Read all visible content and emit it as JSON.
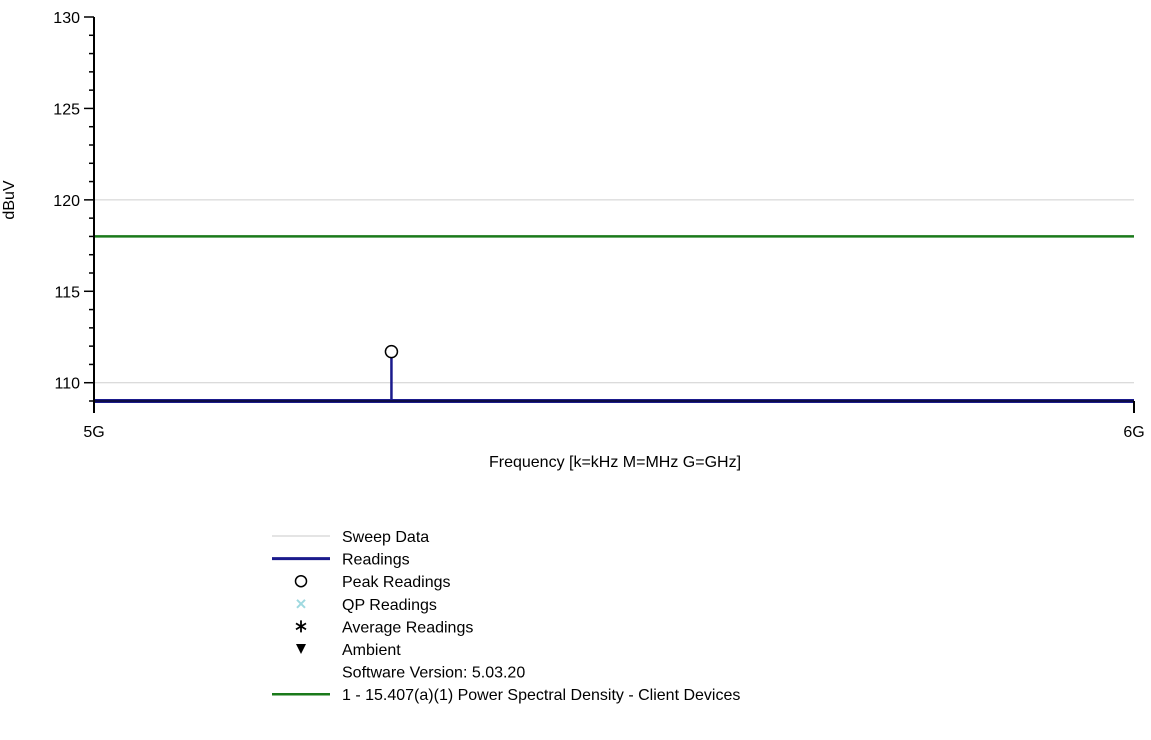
{
  "chart_data": {
    "type": "line",
    "title": "",
    "xlabel": "Frequency [k=kHz M=MHz G=GHz]",
    "ylabel": "dBuV",
    "xlim": [
      5000000000,
      6000000000
    ],
    "ylim": [
      109,
      130
    ],
    "x_ticks": [
      {
        "value": 5000000000,
        "label": "5G"
      },
      {
        "value": 6000000000,
        "label": "6G"
      }
    ],
    "y_ticks": [
      {
        "value": 110,
        "label": "110"
      },
      {
        "value": 115,
        "label": "115"
      },
      {
        "value": 120,
        "label": "120"
      },
      {
        "value": 125,
        "label": "125"
      },
      {
        "value": 130,
        "label": "130"
      }
    ],
    "grid_y": [
      110,
      120
    ],
    "series": [
      {
        "name": "Readings",
        "color": "#1a1a8c",
        "style": "line",
        "x": [
          5000000000,
          6000000000
        ],
        "y": [
          109,
          109
        ]
      },
      {
        "name": "Peak Readings",
        "color": "#000000",
        "style": "stem-circle",
        "x": [
          5286000000
        ],
        "y": [
          111.7
        ]
      },
      {
        "name": "1 - 15.407(a)(1) Power Spectral Density - Client Devices",
        "color": "#1a7a1a",
        "style": "line",
        "x": [
          5000000000,
          6000000000
        ],
        "y": [
          118,
          118
        ]
      }
    ],
    "legend": {
      "placement": "bottom",
      "items": [
        {
          "label": "Sweep Data",
          "symbol": "line",
          "color": "#c8c8c8"
        },
        {
          "label": "Readings",
          "symbol": "line",
          "color": "#1a1a8c"
        },
        {
          "label": "Peak Readings",
          "symbol": "circle",
          "color": "#000000"
        },
        {
          "label": "QP Readings",
          "symbol": "x",
          "color": "#9fd9e0"
        },
        {
          "label": "Average Readings",
          "symbol": "asterisk",
          "color": "#000000"
        },
        {
          "label": "Ambient",
          "symbol": "triangle-down",
          "color": "#000000"
        },
        {
          "label": "Software Version: 5.03.20",
          "symbol": "none",
          "color": "#000000"
        },
        {
          "label": "1 - 15.407(a)(1) Power Spectral Density - Client Devices",
          "symbol": "line",
          "color": "#1a7a1a"
        }
      ]
    }
  }
}
